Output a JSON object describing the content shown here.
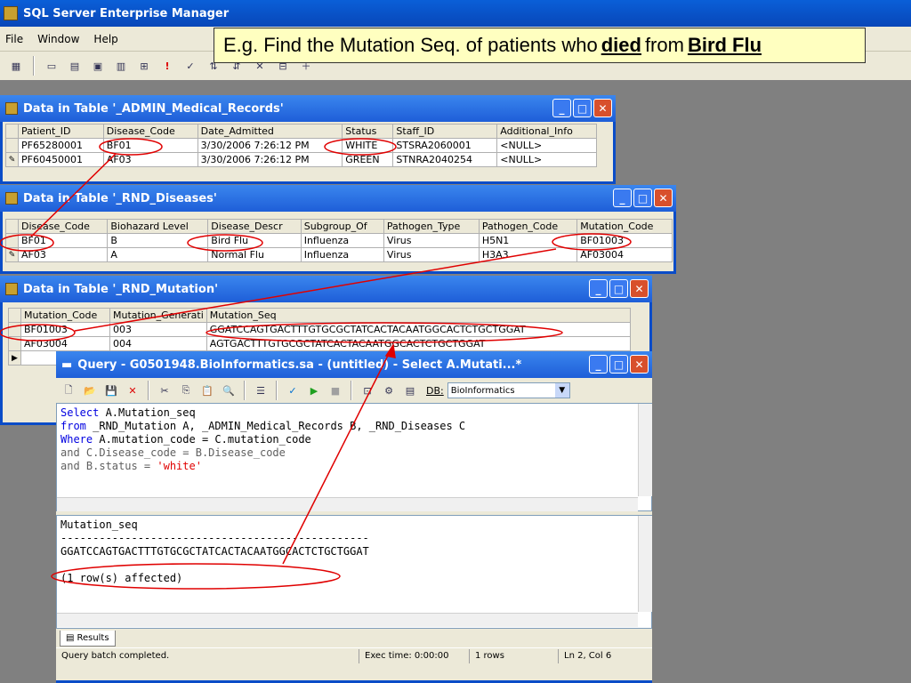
{
  "app": {
    "title": "SQL Server Enterprise Manager",
    "menu": [
      "File",
      "Window",
      "Help"
    ]
  },
  "callout": {
    "prefix": "E.g. Find the Mutation Seq. of patients who",
    "word1": "died",
    "middle": "from",
    "word2": "Bird Flu"
  },
  "medical_window": {
    "title": "Data in Table '_ADMIN_Medical_Records'",
    "columns": [
      "Patient_ID",
      "Disease_Code",
      "Date_Admitted",
      "Status",
      "Staff_ID",
      "Additional_Info"
    ],
    "rows": [
      [
        "PF65280001",
        "BF01",
        "3/30/2006 7:26:12 PM",
        "WHITE",
        "STSRA2060001",
        "<NULL>"
      ],
      [
        "PF60450001",
        "AF03",
        "3/30/2006 7:26:12 PM",
        "GREEN",
        "STNRA2040254",
        "<NULL>"
      ]
    ]
  },
  "diseases_window": {
    "title": "Data in Table '_RND_Diseases'",
    "columns": [
      "Disease_Code",
      "Biohazard Level",
      "Disease_Descr",
      "Subgroup_Of",
      "Pathogen_Type",
      "Pathogen_Code",
      "Mutation_Code"
    ],
    "rows": [
      [
        "BF01",
        "B",
        "Bird Flu",
        "Influenza",
        "Virus",
        "H5N1",
        "BF01003"
      ],
      [
        "AF03",
        "A",
        "Normal Flu",
        "Influenza",
        "Virus",
        "H3A3",
        "AF03004"
      ]
    ]
  },
  "mutation_window": {
    "title": "Data in Table '_RND_Mutation'",
    "columns": [
      "Mutation_Code",
      "Mutation_Generati",
      "Mutation_Seq"
    ],
    "rows": [
      [
        "BF01003",
        "003",
        "GGATCCAGTGACTTTGTGCGCTATCACTACAATGGCACTCTGCTGGAT"
      ],
      [
        "AF03004",
        "004",
        "AGTGACTTTGTGCGCTATCACTACAATGGCACTCTGCTGGAT"
      ]
    ]
  },
  "query_window": {
    "title": "Query - G0501948.BioInformatics.sa - (untitled) - Select A.Mutati...*",
    "db_label": "DB:",
    "db_value": "BioInformatics",
    "sql": {
      "l1_kw": "Select",
      "l1_rest": " A.Mutation_seq",
      "l2_kw": "from",
      "l2_rest": " _RND_Mutation A, _ADMIN_Medical_Records B, _RND_Diseases C",
      "l3_kw": "Where",
      "l3_rest": " A.mutation_code = C.mutation_code",
      "l4": "and C.Disease_code = B.Disease_code",
      "l5_pre": "and B.status = ",
      "l5_str": "'white'"
    },
    "results": {
      "header": "Mutation_seq",
      "divider": "------------------------------------------------",
      "value": "GGATCCAGTGACTTTGTGCGCTATCACTACAATGGCACTCTGCTGGAT",
      "affected": "(1 row(s) affected)"
    },
    "results_tab": "Results",
    "status": {
      "message": "Query batch completed.",
      "exec_time": "Exec time: 0:00:00",
      "rows": "1 rows",
      "position": "Ln 2, Col 6"
    }
  },
  "colors": {
    "annotation": "#e00000",
    "titlebar": "#1e5ed8",
    "highlight": "#ffffc0"
  }
}
